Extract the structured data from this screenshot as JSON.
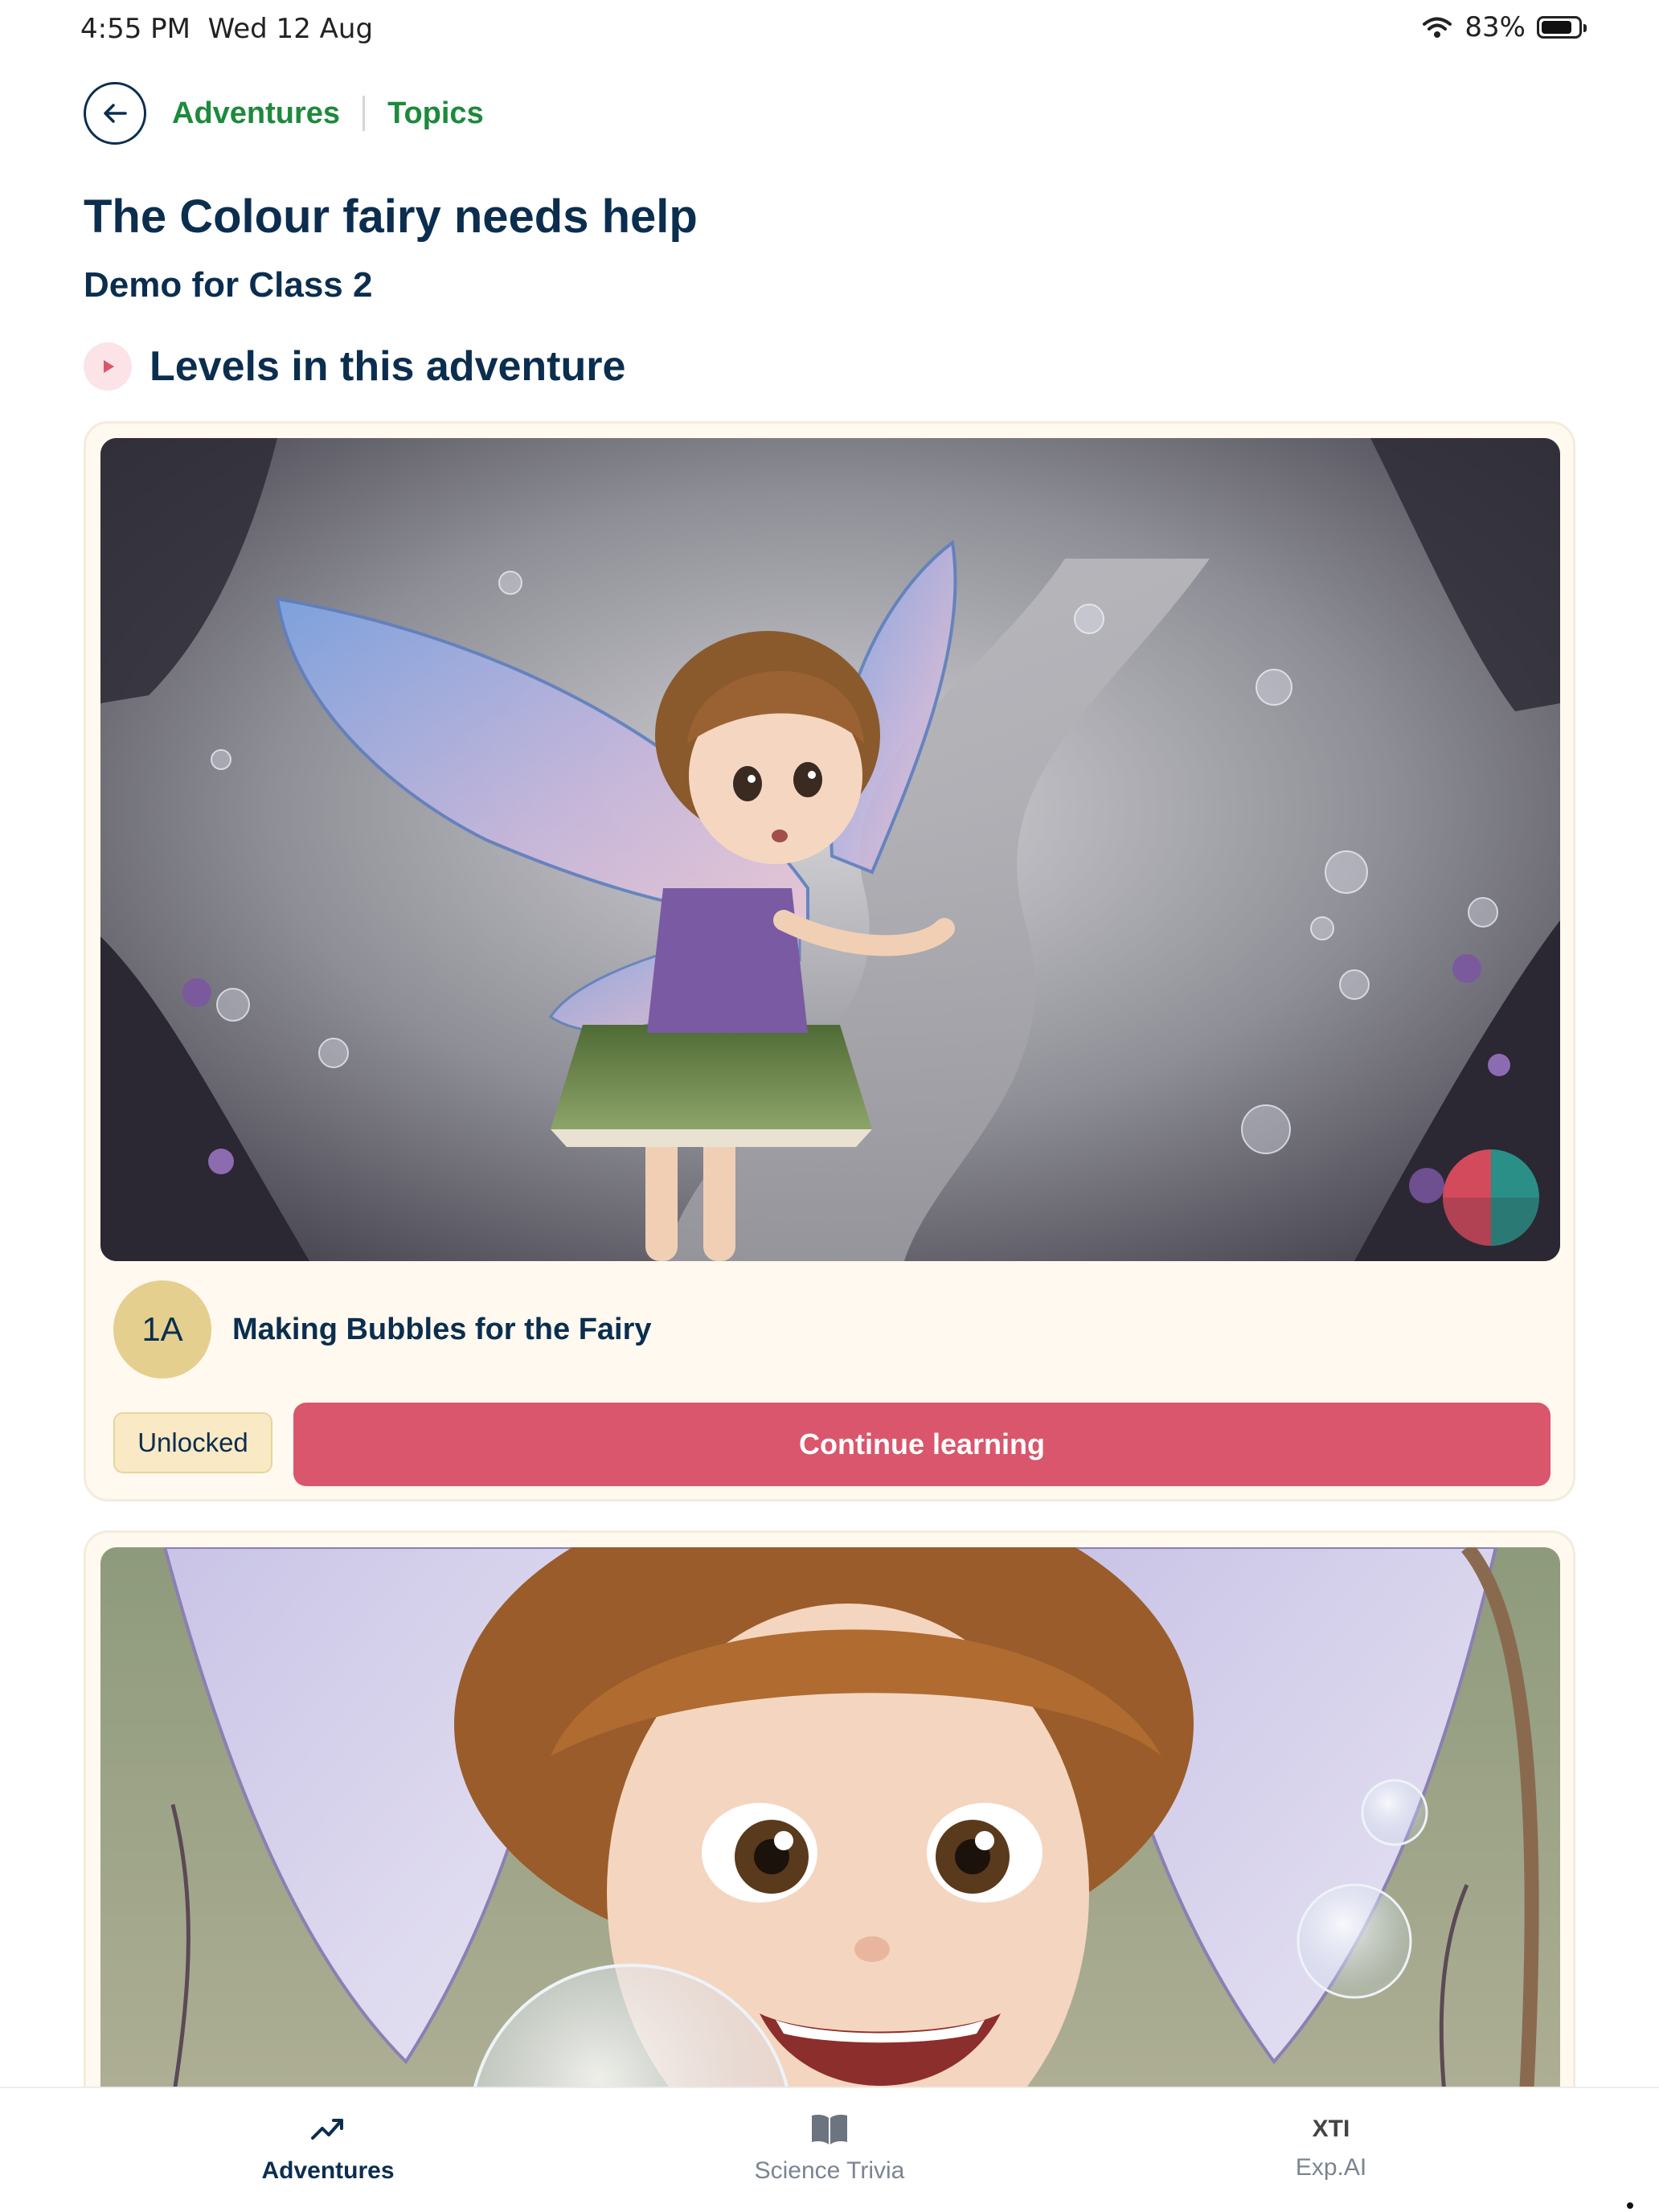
{
  "status_bar": {
    "time": "4:55 PM",
    "date": "Wed 12 Aug",
    "battery": "83%",
    "battery_level": 0.83
  },
  "breadcrumb": {
    "items": [
      "Adventures",
      "Topics"
    ]
  },
  "page": {
    "title": "The Colour fairy needs help",
    "subtitle": "Demo for Class 2",
    "section_heading": "Levels in this adventure"
  },
  "levels": [
    {
      "badge": "1A",
      "title": "Making Bubbles for the Fairy",
      "status": "Unlocked",
      "action": "Continue learning",
      "image": "worried-fairy-illustration"
    },
    {
      "image": "smiling-fairy-illustration"
    }
  ],
  "bottom_nav": {
    "items": [
      {
        "label": "Adventures",
        "icon": "trending-up-icon",
        "active": true
      },
      {
        "label": "Science Trivia",
        "icon": "book-icon",
        "active": false
      },
      {
        "label": "Exp.AI",
        "icon": "xti-logo-icon",
        "glyph": "XTI",
        "active": false
      }
    ]
  },
  "colors": {
    "navy": "#0b2e4f",
    "green": "#1d8a3c",
    "accent": "#d9566c",
    "card_bg": "#fff9ef",
    "badge_gold": "#e4cf8f"
  }
}
